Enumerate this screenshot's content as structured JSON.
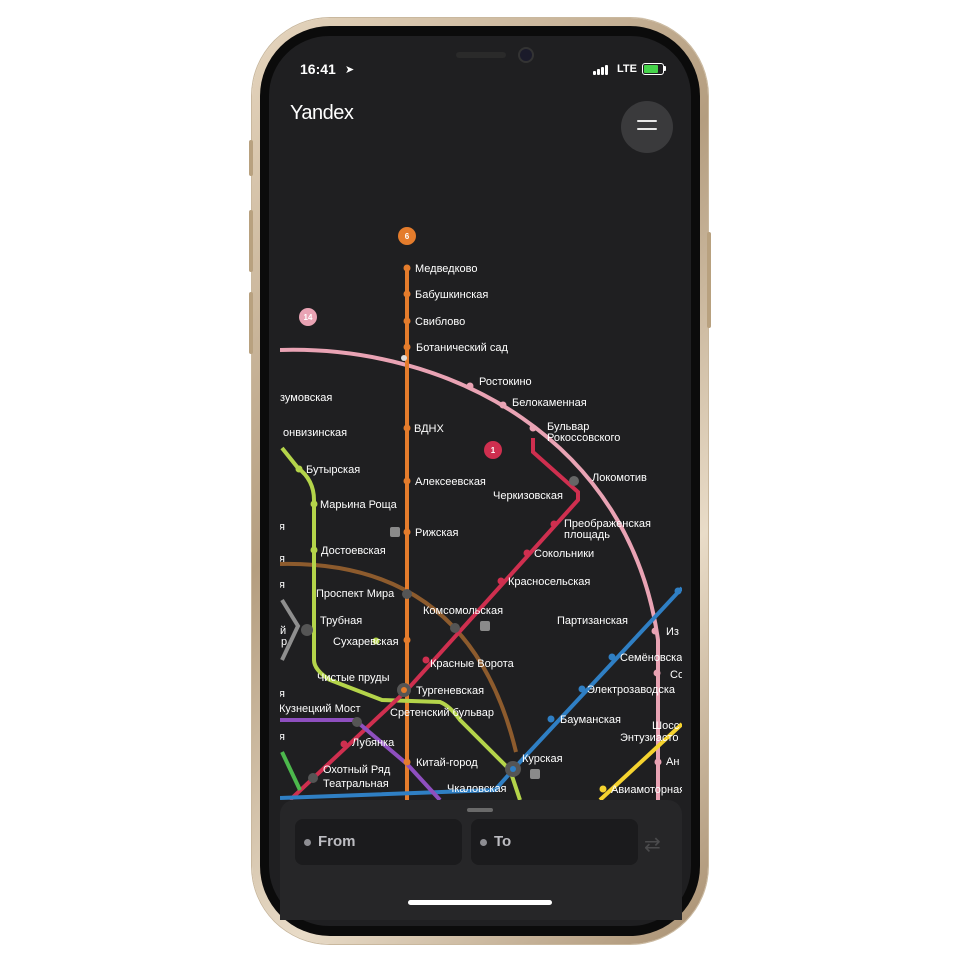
{
  "status_bar": {
    "time": "16:41",
    "network": "LTE"
  },
  "header": {
    "logo": "Yandex"
  },
  "map": {
    "line_badges": [
      {
        "label": "6",
        "color": "#e47c2c"
      },
      {
        "label": "14",
        "color": "#e9a3b4"
      },
      {
        "label": "1",
        "color": "#cf2f4f"
      }
    ],
    "stations": {
      "medvedkovo": "Медведково",
      "babushkinskaya": "Бабушкинская",
      "sviblovo": "Свиблово",
      "botanicheskiy_sad": "Ботанический сад",
      "rostokino": "Ростокино",
      "belokamennaya": "Белокаменная",
      "razumovskaya": "зумовская",
      "fonvizinskaya": "онвизинская",
      "bulvar_rokossovskogo_1": "Бульвар",
      "bulvar_rokossovskogo_2": "Рокоссовского",
      "vdnh": "ВДНХ",
      "butyrskaya": "Бутырская",
      "lokomotiv": "Локомотив",
      "alekseevskaya": "Алексеевская",
      "cherkizovskaya": "Черкизовская",
      "maryina_roshcha": "Марьина Роща",
      "preobrazhenskaya_1": "Преображенская",
      "preobrazhenskaya_2": "площадь",
      "rizhskaya": "Рижская",
      "sokolniki": "Сокольники",
      "dostoevskaya": "Достоевская",
      "krasnoselskaya": "Красносельская",
      "prospekt_mira": "Проспект Мира",
      "komsomolskaya": "Комсомольская",
      "partizanskaya": "Партизанская",
      "trubnaya": "Трубная",
      "sukharevskaya": "Сухаревская",
      "izmaylovo": "Из",
      "krasnye_vorota": "Красные Ворота",
      "semenovskaya": "Семёновска",
      "chistye_prudy": "Чистые пруды",
      "so": "Со",
      "turgenevskaya": "Тургеневская",
      "elektrozavodskaya": "Электрозаводска",
      "kuznetsky_most": "Кузнецкий Мост",
      "sretensky_bulvar": "Сретенский бульвар",
      "baumanskaya": "Бауманская",
      "shosse_1": "Шосс",
      "shosse_2": "Энтузиасто",
      "lubyanka": "Лубянка",
      "kurskaya": "Курская",
      "an": "Ан",
      "kitay_gorod": "Китай-город",
      "okhotny_ryad": "Охотный Ряд",
      "teatralnaya": "Театральная",
      "chkalovskaya": "Чкаловская",
      "aviamotornaya": "Авиамоторная",
      "left_ya_1": "я",
      "left_ya_2": "я",
      "left_ya_3": "я",
      "left_y": "й",
      "left_r": "р",
      "left_ya_4": "я",
      "left_ya_5": "я"
    },
    "line_colors": {
      "kaluzhsko_rizhskaya": "#e47c2c",
      "mck": "#e9a3b4",
      "sokolnicheskaya": "#cf2f4f",
      "lyublinskaya": "#b4d44a",
      "koltsevaya": "#8d5b2d",
      "arbatsko_pokrovskaya": "#2f7fc4",
      "tagansko_krasnopresnenskaya": "#8e4fbf",
      "kalininskaya": "#f5d32f",
      "serpukhovskaya": "#8f8f8f",
      "filevskaya": "#3fb5e6"
    }
  },
  "route_panel": {
    "from_placeholder": "From",
    "to_placeholder": "To",
    "swap_icon": "⇄"
  }
}
